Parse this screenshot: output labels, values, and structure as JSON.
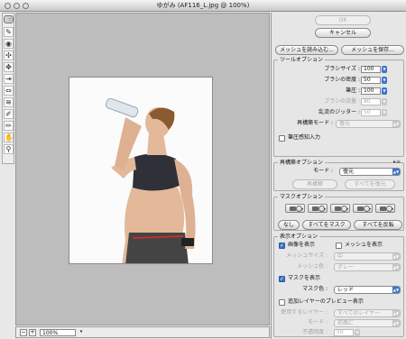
{
  "window": {
    "title": "ゆがみ (AF116_L.jpg @ 100%)"
  },
  "buttons": {
    "ok": "OK",
    "cancel": "キャンセル",
    "load_mesh": "メッシュを読み込む...",
    "save_mesh": "メッシュを保存..."
  },
  "tool_options": {
    "title": "ツールオプション",
    "brush_size": {
      "label": "ブラシサイズ :",
      "value": "100"
    },
    "brush_density": {
      "label": "ブラシの密度 :",
      "value": "50"
    },
    "brush_pressure": {
      "label": "筆圧 :",
      "value": "100"
    },
    "brush_rate": {
      "label": "ブラシの流量 :",
      "value": "80"
    },
    "turbulent_jitter": {
      "label": "乱流のジッター :",
      "value": "50"
    },
    "reconstruct_mode": {
      "label": "再構築モード :",
      "value": "復元"
    },
    "stylus_pressure": "筆圧感知入力"
  },
  "reconstruct_options": {
    "title": "再構築オプション",
    "mode_label": "モード :",
    "mode_value": "復元",
    "reconstruct": "再構築",
    "restore_all": "すべてを復元"
  },
  "mask_options": {
    "title": "マスクオプション",
    "none": "なし",
    "mask_all": "すべてをマスク",
    "invert_all": "すべてを反転"
  },
  "view_options": {
    "title": "表示オプション",
    "show_image": "画像を表示",
    "show_mesh": "メッシュを表示",
    "mesh_size": {
      "label": "メッシュサイズ :",
      "value": "中"
    },
    "mesh_color": {
      "label": "メッシュ色 :",
      "value": "グレー"
    },
    "show_mask": "マスクを表示",
    "mask_color": {
      "label": "マスク色 :",
      "value": "レッド"
    },
    "show_backdrop": "追加レイヤーのプレビュー表示",
    "use": {
      "label": "使用するレイヤー :",
      "value": "すべてのレイヤー"
    },
    "mode": {
      "label": "モード :",
      "value": "前面に"
    },
    "opacity": {
      "label": "不透明度 :",
      "value": "50"
    }
  },
  "status": {
    "zoom": "100%"
  },
  "icons": {
    "tools": [
      "forward-warp-tool-icon",
      "reconstruct-tool-icon",
      "twirl-clockwise-tool-icon",
      "pucker-tool-icon",
      "bloat-tool-icon",
      "push-left-tool-icon",
      "mirror-tool-icon",
      "turbulence-tool-icon",
      "freeze-mask-tool-icon",
      "thaw-mask-tool-icon",
      "hand-tool-icon",
      "zoom-tool-icon"
    ]
  },
  "colors": {
    "accent": "#3c74c8",
    "canvas": "#bdbdbd"
  }
}
